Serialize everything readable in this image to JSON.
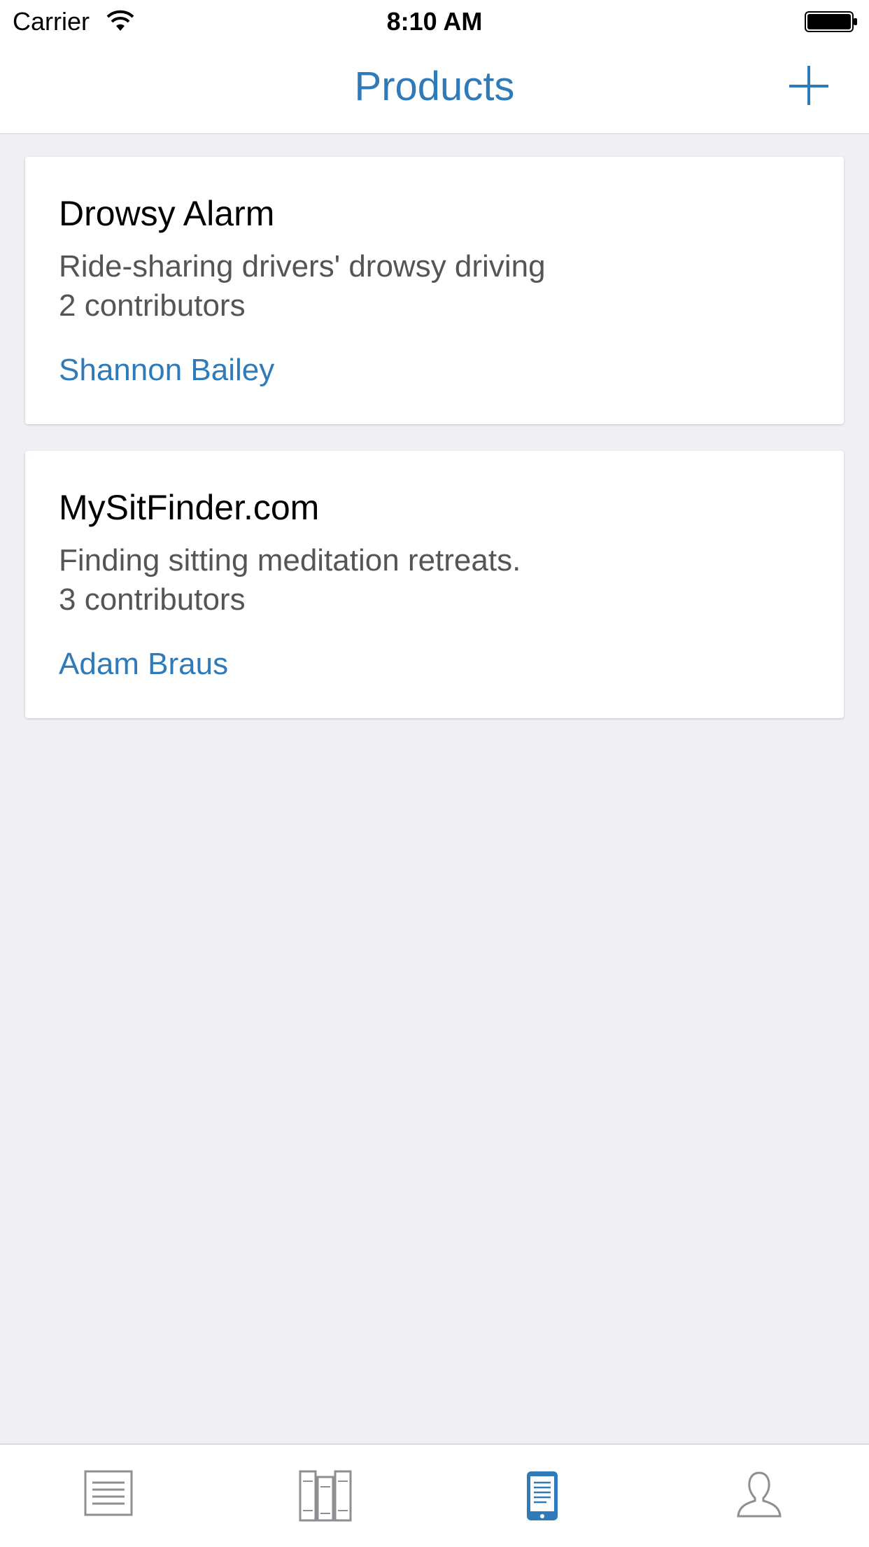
{
  "status": {
    "carrier": "Carrier",
    "time": "8:10 AM"
  },
  "nav": {
    "title": "Products"
  },
  "products": [
    {
      "title": "Drowsy Alarm",
      "description": "Ride-sharing drivers' drowsy driving",
      "contributors": "2 contributors",
      "owner": "Shannon Bailey"
    },
    {
      "title": "MySitFinder.com",
      "description": "Finding sitting meditation retreats.",
      "contributors": "3 contributors",
      "owner": "Adam Braus"
    }
  ],
  "tabs": [
    {
      "icon": "list-icon",
      "active": false
    },
    {
      "icon": "library-icon",
      "active": false
    },
    {
      "icon": "mobile-icon",
      "active": true
    },
    {
      "icon": "profile-icon",
      "active": false
    }
  ],
  "colors": {
    "accent": "#2f7ab9",
    "background": "#efeff4",
    "inactive_icon": "#8e8e93"
  }
}
